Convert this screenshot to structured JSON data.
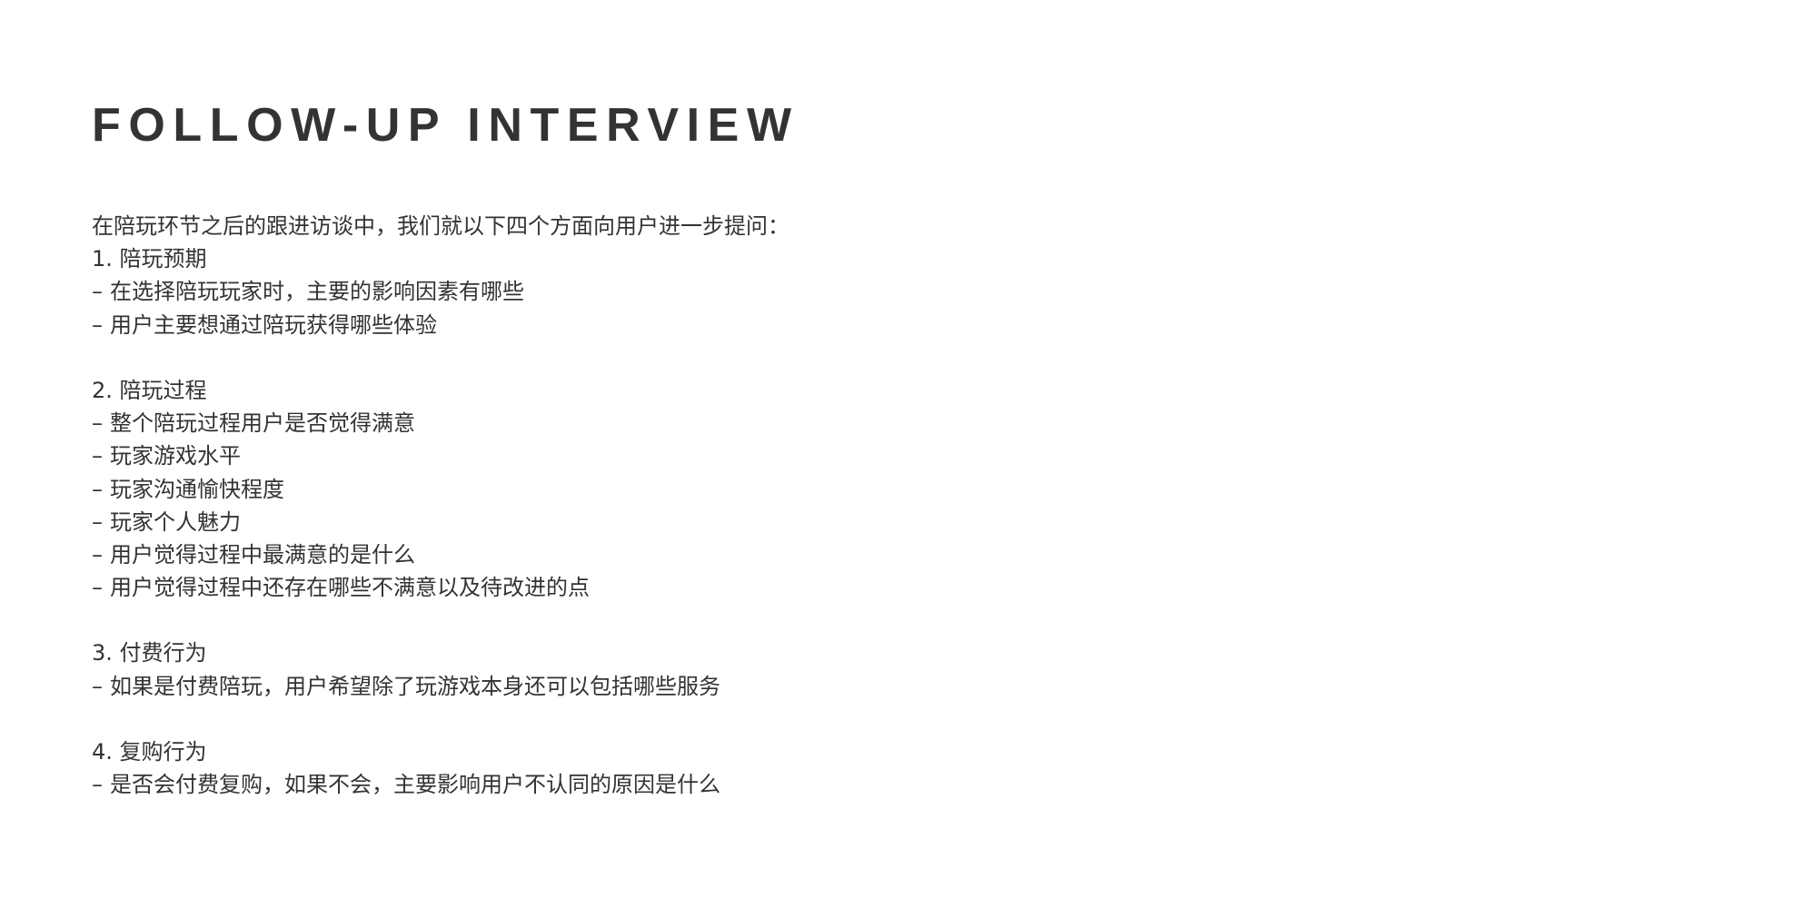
{
  "title": "FOLLOW-UP INTERVIEW",
  "intro": "在陪玩环节之后的跟进访谈中，我们就以下四个方面向用户进一步提问：",
  "dash": "–",
  "sections": [
    {
      "heading": "1. 陪玩预期",
      "items": [
        "在选择陪玩玩家时，主要的影响因素有哪些",
        "用户主要想通过陪玩获得哪些体验"
      ]
    },
    {
      "heading": "2. 陪玩过程",
      "items": [
        "整个陪玩过程用户是否觉得满意",
        "玩家游戏水平",
        "玩家沟通愉快程度",
        "玩家个人魅力",
        "用户觉得过程中最满意的是什么",
        "用户觉得过程中还存在哪些不满意以及待改进的点"
      ]
    },
    {
      "heading": "3. 付费行为",
      "items": [
        "如果是付费陪玩，用户希望除了玩游戏本身还可以包括哪些服务"
      ]
    },
    {
      "heading": "4. 复购行为",
      "items": [
        "是否会付费复购，如果不会，主要影响用户不认同的原因是什么"
      ]
    }
  ]
}
